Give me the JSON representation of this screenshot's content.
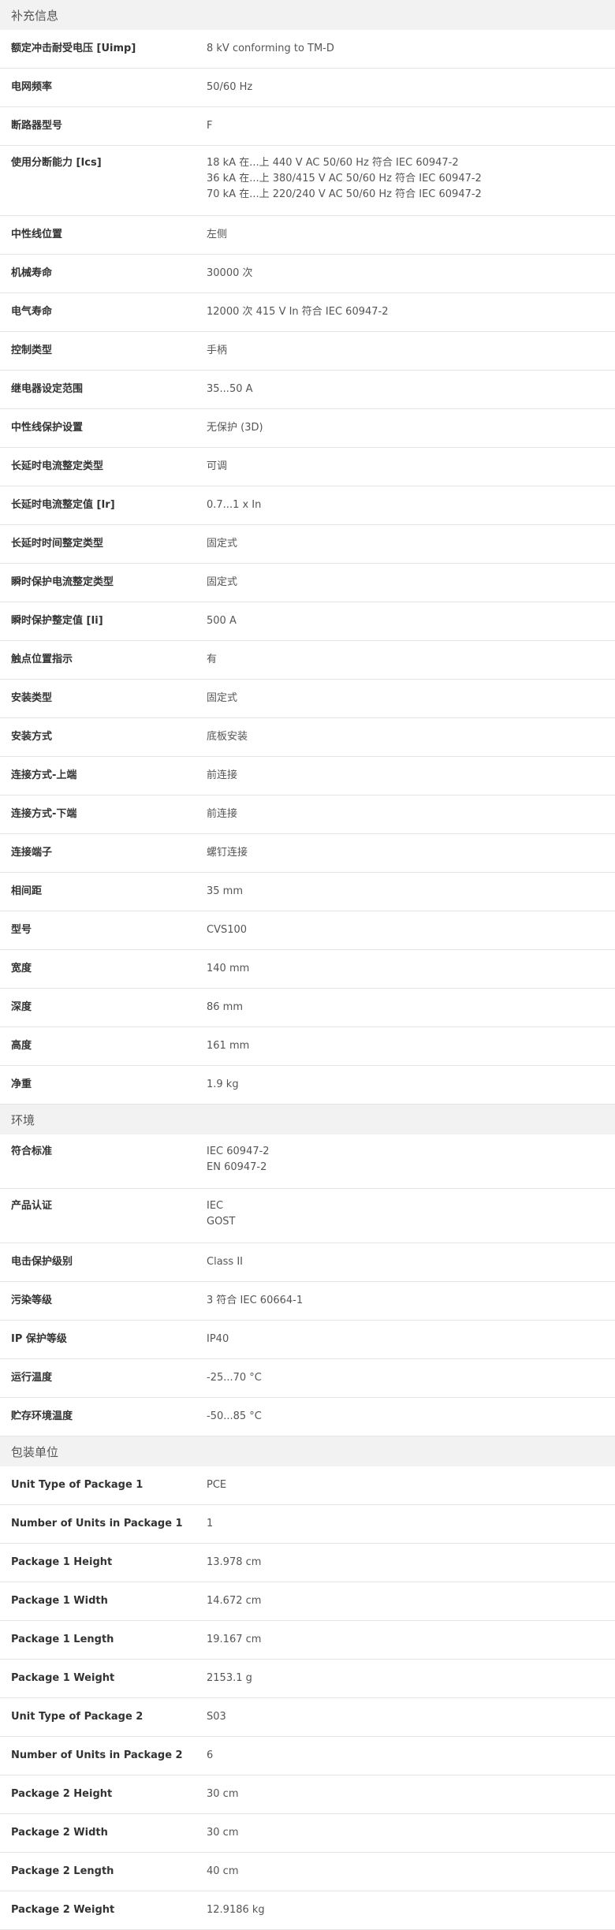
{
  "sections": [
    {
      "title": "补充信息",
      "rows": [
        {
          "label": "额定冲击耐受电压 [Uimp]",
          "values": [
            "8 kV conforming to TM-D"
          ]
        },
        {
          "label": "电网频率",
          "values": [
            "50/60 Hz"
          ]
        },
        {
          "label": "断路器型号",
          "values": [
            "F"
          ]
        },
        {
          "label": "使用分断能力 [Ics]",
          "values": [
            "18 kA 在...上 440 V AC 50/60 Hz 符合 IEC 60947-2",
            "36 kA 在...上 380/415 V AC 50/60 Hz 符合 IEC 60947-2",
            "70 kA 在...上 220/240 V AC 50/60 Hz 符合 IEC 60947-2"
          ]
        },
        {
          "label": "中性线位置",
          "values": [
            "左侧"
          ]
        },
        {
          "label": "机械寿命",
          "values": [
            "30000 次"
          ]
        },
        {
          "label": "电气寿命",
          "values": [
            "12000 次 415 V In 符合 IEC 60947-2"
          ]
        },
        {
          "label": "控制类型",
          "values": [
            "手柄"
          ]
        },
        {
          "label": "继电器设定范围",
          "values": [
            "35...50 A"
          ]
        },
        {
          "label": "中性线保护设置",
          "values": [
            "无保护 (3D)"
          ]
        },
        {
          "label": "长延时电流整定类型",
          "values": [
            "可调"
          ]
        },
        {
          "label": "长延时电流整定值 [Ir]",
          "values": [
            "0.7...1 x In"
          ]
        },
        {
          "label": "长延时时间整定类型",
          "values": [
            "固定式"
          ]
        },
        {
          "label": "瞬时保护电流整定类型",
          "values": [
            "固定式"
          ]
        },
        {
          "label": "瞬时保护整定值 [Ii]",
          "values": [
            "500 A"
          ]
        },
        {
          "label": "触点位置指示",
          "values": [
            "有"
          ]
        },
        {
          "label": "安装类型",
          "values": [
            "固定式"
          ]
        },
        {
          "label": "安装方式",
          "values": [
            "底板安装"
          ]
        },
        {
          "label": "连接方式-上端",
          "values": [
            "前连接"
          ]
        },
        {
          "label": "连接方式-下端",
          "values": [
            "前连接"
          ]
        },
        {
          "label": "连接端子",
          "values": [
            "螺钉连接"
          ]
        },
        {
          "label": "相间距",
          "values": [
            "35 mm"
          ]
        },
        {
          "label": "型号",
          "values": [
            "CVS100"
          ]
        },
        {
          "label": "宽度",
          "values": [
            "140 mm"
          ]
        },
        {
          "label": "深度",
          "values": [
            "86 mm"
          ]
        },
        {
          "label": "高度",
          "values": [
            "161 mm"
          ]
        },
        {
          "label": "净重",
          "values": [
            "1.9 kg"
          ]
        }
      ]
    },
    {
      "title": "环境",
      "rows": [
        {
          "label": "符合标准",
          "values": [
            "IEC 60947-2",
            "EN 60947-2"
          ]
        },
        {
          "label": "产品认证",
          "values": [
            "IEC",
            "GOST"
          ]
        },
        {
          "label": "电击保护级别",
          "values": [
            "Class II"
          ]
        },
        {
          "label": "污染等级",
          "values": [
            "3 符合 IEC 60664-1"
          ]
        },
        {
          "label": "IP 保护等级",
          "values": [
            "IP40"
          ]
        },
        {
          "label": "运行温度",
          "values": [
            "-25...70 °C"
          ]
        },
        {
          "label": "贮存环境温度",
          "values": [
            "-50...85 °C"
          ]
        }
      ]
    },
    {
      "title": "包装单位",
      "rows": [
        {
          "label": "Unit Type of Package 1",
          "values": [
            "PCE"
          ]
        },
        {
          "label": "Number of Units in Package 1",
          "values": [
            "1"
          ]
        },
        {
          "label": "Package 1 Height",
          "values": [
            "13.978 cm"
          ]
        },
        {
          "label": "Package 1 Width",
          "values": [
            "14.672 cm"
          ]
        },
        {
          "label": "Package 1 Length",
          "values": [
            "19.167 cm"
          ]
        },
        {
          "label": "Package 1 Weight",
          "values": [
            "2153.1 g"
          ]
        },
        {
          "label": "Unit Type of Package 2",
          "values": [
            "S03"
          ]
        },
        {
          "label": "Number of Units in Package 2",
          "values": [
            "6"
          ]
        },
        {
          "label": "Package 2 Height",
          "values": [
            "30 cm"
          ]
        },
        {
          "label": "Package 2 Width",
          "values": [
            "30 cm"
          ]
        },
        {
          "label": "Package 2 Length",
          "values": [
            "40 cm"
          ]
        },
        {
          "label": "Package 2 Weight",
          "values": [
            "12.9186 kg"
          ]
        }
      ]
    }
  ]
}
